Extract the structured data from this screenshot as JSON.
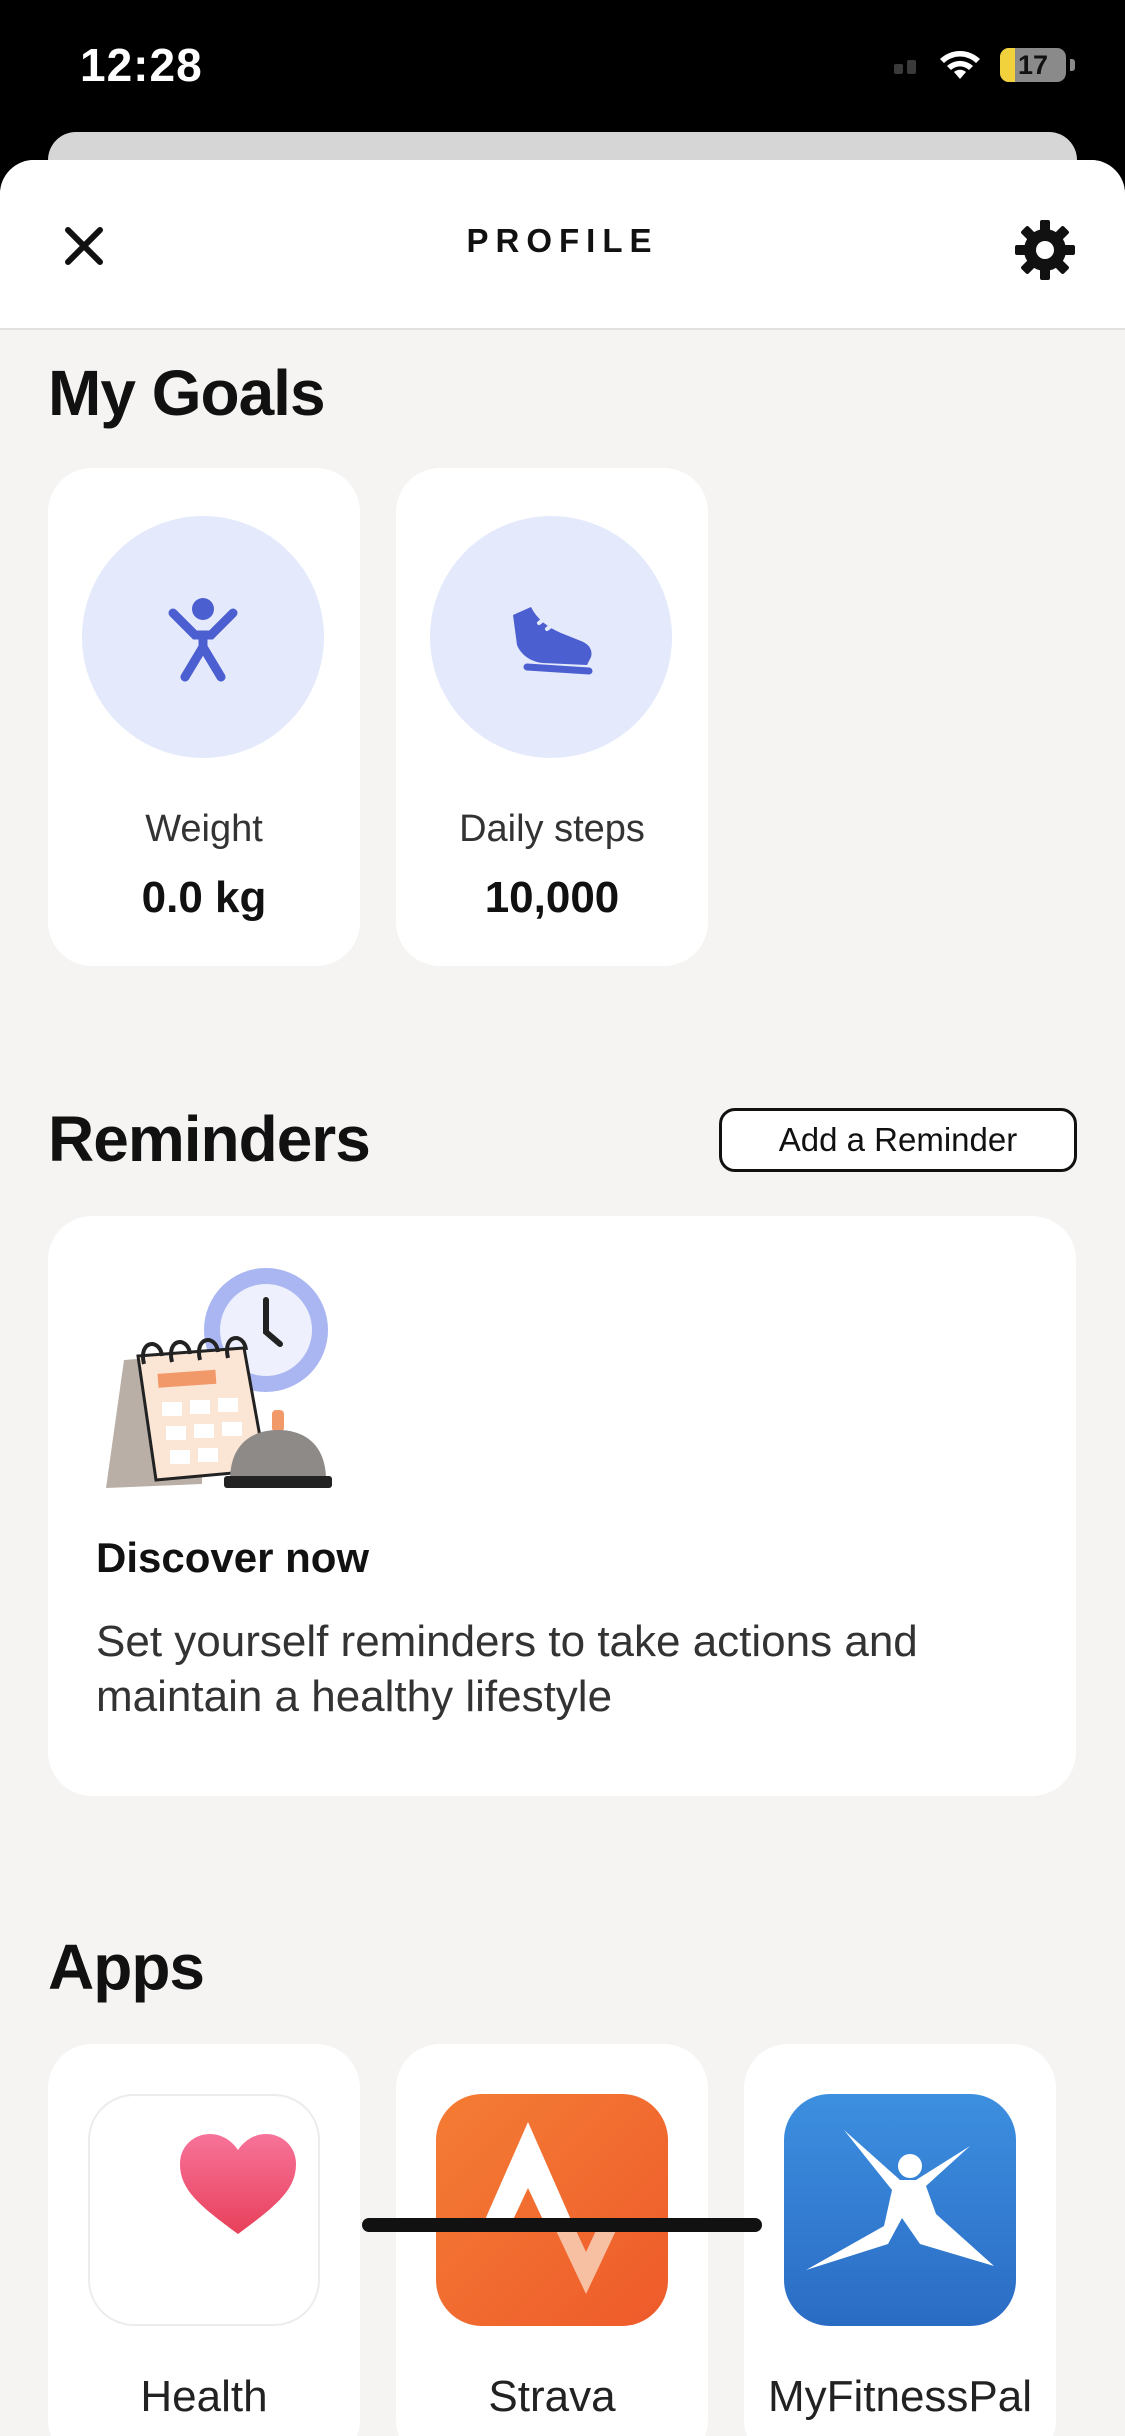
{
  "status_bar": {
    "time": "12:28",
    "battery_level": "17",
    "icons": [
      "signal-icon",
      "wifi-icon",
      "battery-icon"
    ]
  },
  "header": {
    "title": "PROFILE",
    "close_icon": "close-icon",
    "settings_icon": "gear-icon"
  },
  "goals": {
    "title": "My Goals",
    "items": [
      {
        "label": "Weight",
        "value": "0.0 kg",
        "icon": "person-icon"
      },
      {
        "label": "Daily steps",
        "value": "10,000",
        "icon": "shoe-icon"
      }
    ]
  },
  "reminders": {
    "title": "Reminders",
    "add_label": "Add a Reminder",
    "card": {
      "title": "Discover now",
      "text": "Set yourself reminders to take actions and maintain a healthy lifestyle",
      "illustration": "calendar-clock-bell-illustration"
    }
  },
  "apps": {
    "title": "Apps",
    "items": [
      {
        "label": "Health",
        "icon": "heart-icon"
      },
      {
        "label": "Strava",
        "icon": "strava-logo-icon"
      },
      {
        "label": "MyFitnessPal",
        "icon": "myfitnesspal-logo-icon"
      }
    ]
  },
  "colors": {
    "accent_blue": "#4c5fd0",
    "goal_circle": "#e4eafc",
    "background": "#f5f4f2",
    "strava_orange": "#f0602a",
    "mfp_blue": "#2f7ed8",
    "health_pink": "#ec4a6a",
    "battery_yellow": "#f2d23c"
  }
}
